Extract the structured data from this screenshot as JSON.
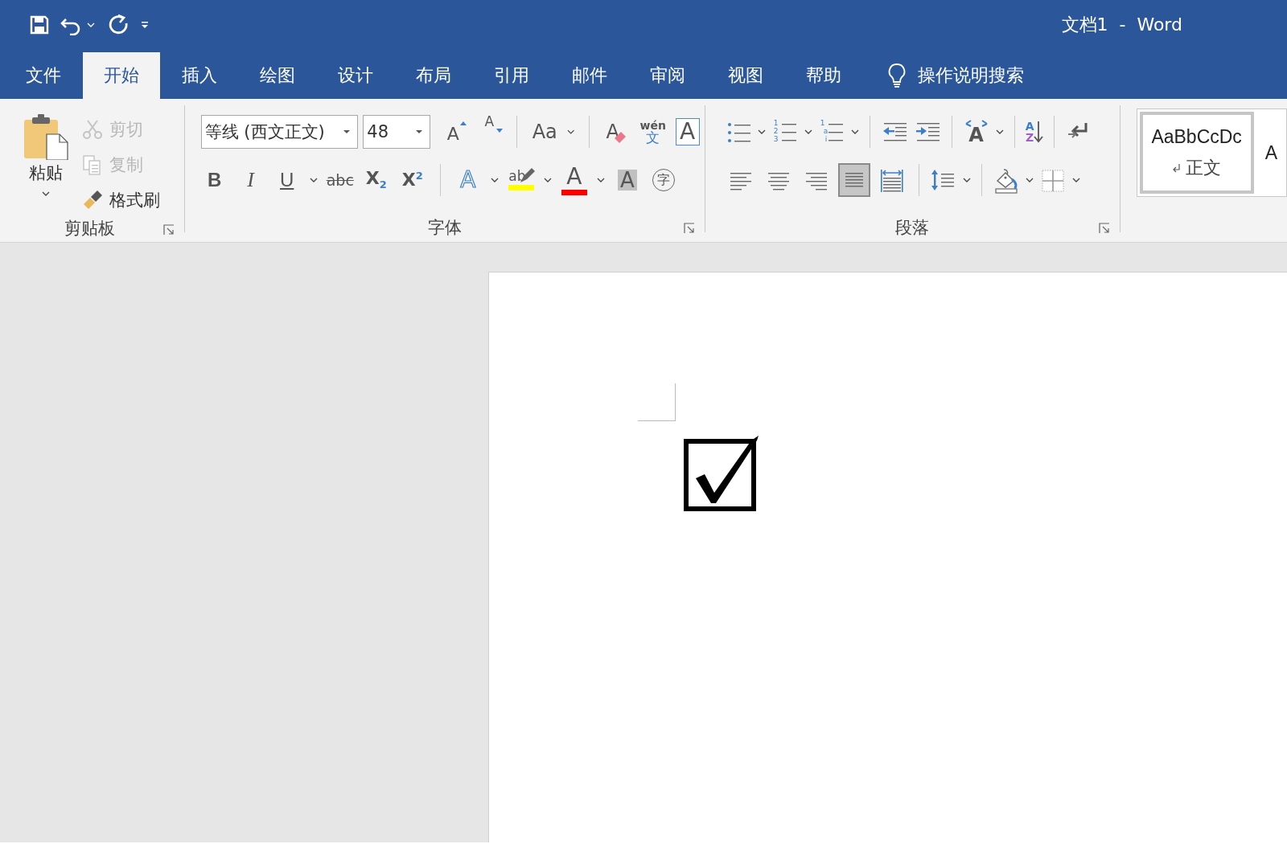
{
  "window": {
    "title": "文档1  -  Word"
  },
  "tabs": [
    {
      "label": "文件",
      "selected": false
    },
    {
      "label": "开始",
      "selected": true
    },
    {
      "label": "插入",
      "selected": false
    },
    {
      "label": "绘图",
      "selected": false
    },
    {
      "label": "设计",
      "selected": false
    },
    {
      "label": "布局",
      "selected": false
    },
    {
      "label": "引用",
      "selected": false
    },
    {
      "label": "邮件",
      "selected": false
    },
    {
      "label": "审阅",
      "selected": false
    },
    {
      "label": "视图",
      "selected": false
    },
    {
      "label": "帮助",
      "selected": false
    }
  ],
  "tell_me": {
    "label": "操作说明搜索"
  },
  "clipboard": {
    "paste": "粘贴",
    "group_label": "剪贴板",
    "items": [
      {
        "kind": "cut",
        "label": "剪切",
        "disabled": true
      },
      {
        "kind": "copy",
        "label": "复制",
        "disabled": true
      },
      {
        "kind": "painter",
        "label": "格式刷",
        "disabled": false
      }
    ]
  },
  "font": {
    "font_name": "等线 (西文正文)",
    "font_size": "48",
    "group_label": "字体",
    "row_1": [
      {
        "kind": "grow",
        "text": "A",
        "dropdown": false
      },
      {
        "kind": "shrink",
        "text": "A",
        "dropdown": false
      },
      {
        "kind": "case",
        "text": "Aa",
        "dropdown": true
      },
      {
        "kind": "clear",
        "text": "A",
        "dropdown": false
      },
      {
        "kind": "phonetic",
        "text": "wén",
        "sub_text": "文",
        "dropdown": false
      },
      {
        "kind": "border",
        "text": "A",
        "dropdown": false
      }
    ],
    "row_2": [
      {
        "kind": "bold",
        "text": "B",
        "dropdown": false
      },
      {
        "kind": "italic",
        "text": "I",
        "dropdown": false
      },
      {
        "kind": "underline",
        "text": "U",
        "dropdown": true
      },
      {
        "kind": "strike",
        "text": "abc",
        "dropdown": false
      },
      {
        "kind": "sub",
        "text": "X$_{2}$",
        "dropdown": false
      },
      {
        "kind": "sup",
        "text": "X$^{2}$",
        "dropdown": false
      },
      {
        "kind": "effects",
        "text": "A",
        "dropdown": true
      },
      {
        "kind": "highlight",
        "text": "ab",
        "color": "#ffff00",
        "dropdown": true
      },
      {
        "kind": "color",
        "text": "A",
        "color": "#ff0000",
        "dropdown": true
      },
      {
        "kind": "shade",
        "text": "A",
        "dropdown": false
      },
      {
        "kind": "enclose",
        "text": "字",
        "dropdown": false
      }
    ]
  },
  "paragraph": {
    "group_label": "段落",
    "row_1": [
      {
        "kind": "bullets",
        "dropdown": true
      },
      {
        "kind": "numbering",
        "marks": [
          "1",
          "2",
          "3"
        ],
        "dropdown": true
      },
      {
        "kind": "multilevel",
        "marks": [
          "1",
          "a",
          "i"
        ],
        "dropdown": true
      },
      {
        "kind": "outdent",
        "dropdown": false
      },
      {
        "kind": "indent",
        "dropdown": false
      },
      {
        "kind": "asian",
        "text": "A",
        "dropdown": true
      },
      {
        "kind": "sort",
        "marks": [
          "A",
          "Z"
        ],
        "dropdown": false
      },
      {
        "kind": "marks",
        "dropdown": false
      }
    ],
    "row_2": [
      {
        "kind": "left",
        "selected": false,
        "dropdown": false
      },
      {
        "kind": "center",
        "selected": false,
        "dropdown": false
      },
      {
        "kind": "right",
        "selected": false,
        "dropdown": false
      },
      {
        "kind": "justify",
        "selected": true,
        "dropdown": false
      },
      {
        "kind": "distributed",
        "selected": false,
        "dropdown": false
      },
      {
        "kind": "spacing",
        "dropdown": true
      },
      {
        "kind": "shading",
        "dropdown": true
      },
      {
        "kind": "borders",
        "dropdown": true
      }
    ]
  },
  "styles": [
    {
      "preview": "AaBbCcDc",
      "label": "正文",
      "selected": true
    },
    {
      "preview": "A",
      "selected": false
    }
  ]
}
